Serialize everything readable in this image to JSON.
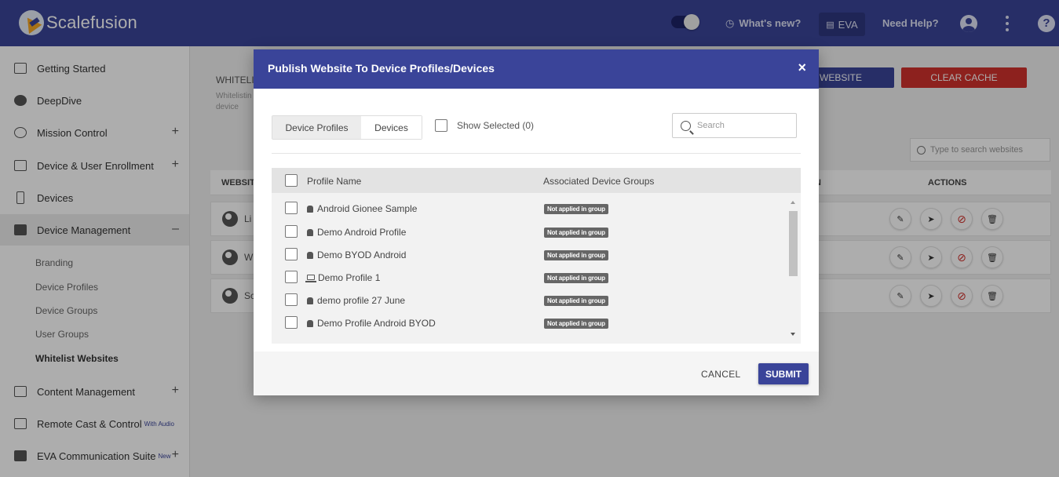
{
  "header": {
    "brand": "Scalefusion",
    "whats_new": "What's new?",
    "eva": "EVA",
    "need_help": "Need Help?"
  },
  "sidebar": {
    "items": [
      {
        "label": "Getting Started",
        "icon": "enter-icon",
        "plus": ""
      },
      {
        "label": "DeepDive",
        "icon": "gauge-icon",
        "plus": ""
      },
      {
        "label": "Mission Control",
        "icon": "console-icon",
        "plus": "+"
      },
      {
        "label": "Device & User Enrollment",
        "icon": "devices-icon",
        "plus": "+"
      },
      {
        "label": "Devices",
        "icon": "phone-icon",
        "plus": ""
      },
      {
        "label": "Device Management",
        "icon": "briefcase-icon",
        "plus": "–"
      }
    ],
    "sub_items": [
      {
        "label": "Branding"
      },
      {
        "label": "Device Profiles"
      },
      {
        "label": "Device Groups"
      },
      {
        "label": "User Groups"
      },
      {
        "label": "Whitelist Websites"
      }
    ],
    "bottom_items": [
      {
        "label": "Content Management",
        "icon": "folder-icon",
        "sup": "",
        "plus": "+"
      },
      {
        "label": "Remote Cast & Control",
        "icon": "cast-icon",
        "sup": "With Audio",
        "plus": ""
      },
      {
        "label": "EVA Communication Suite",
        "icon": "chat-icon",
        "sup": "New",
        "plus": "+"
      }
    ]
  },
  "background": {
    "title": "WHITELI",
    "desc": "Whitelistin device",
    "website_btn": "WEBSITE",
    "clear_cache_btn": "CLEAR CACHE",
    "search_placeholder": "Type to search websites",
    "th_website": "WEBSITE",
    "th_mid": "N",
    "th_actions": "ACTIONS",
    "rows": [
      {
        "name": "Li"
      },
      {
        "name": "Wi"
      },
      {
        "name": "Sc"
      }
    ]
  },
  "modal": {
    "title": "Publish Website To Device Profiles/Devices",
    "close": "×",
    "tab_profiles": "Device Profiles",
    "tab_devices": "Devices",
    "show_selected": "Show Selected (0)",
    "search_placeholder": "Search",
    "th_profile_name": "Profile Name",
    "th_groups": "Associated Device Groups",
    "rows": [
      {
        "name": "Android Gionee Sample",
        "type": "android-icon",
        "badge": "Not applied in group"
      },
      {
        "name": "Demo Android Profile",
        "type": "android-icon",
        "badge": "Not applied in group"
      },
      {
        "name": "Demo BYOD Android",
        "type": "android-icon",
        "badge": "Not applied in group"
      },
      {
        "name": "Demo Profile 1",
        "type": "laptop-icon",
        "badge": "Not applied in group"
      },
      {
        "name": "demo profile 27 June",
        "type": "android-icon",
        "badge": "Not applied in group"
      },
      {
        "name": "Demo Profile Android BYOD",
        "type": "android-icon",
        "badge": "Not applied in group"
      }
    ],
    "cancel": "CANCEL",
    "submit": "SUBMIT"
  },
  "colors": {
    "primary": "#3a4499",
    "danger": "#d0312d",
    "badge": "#666666"
  }
}
